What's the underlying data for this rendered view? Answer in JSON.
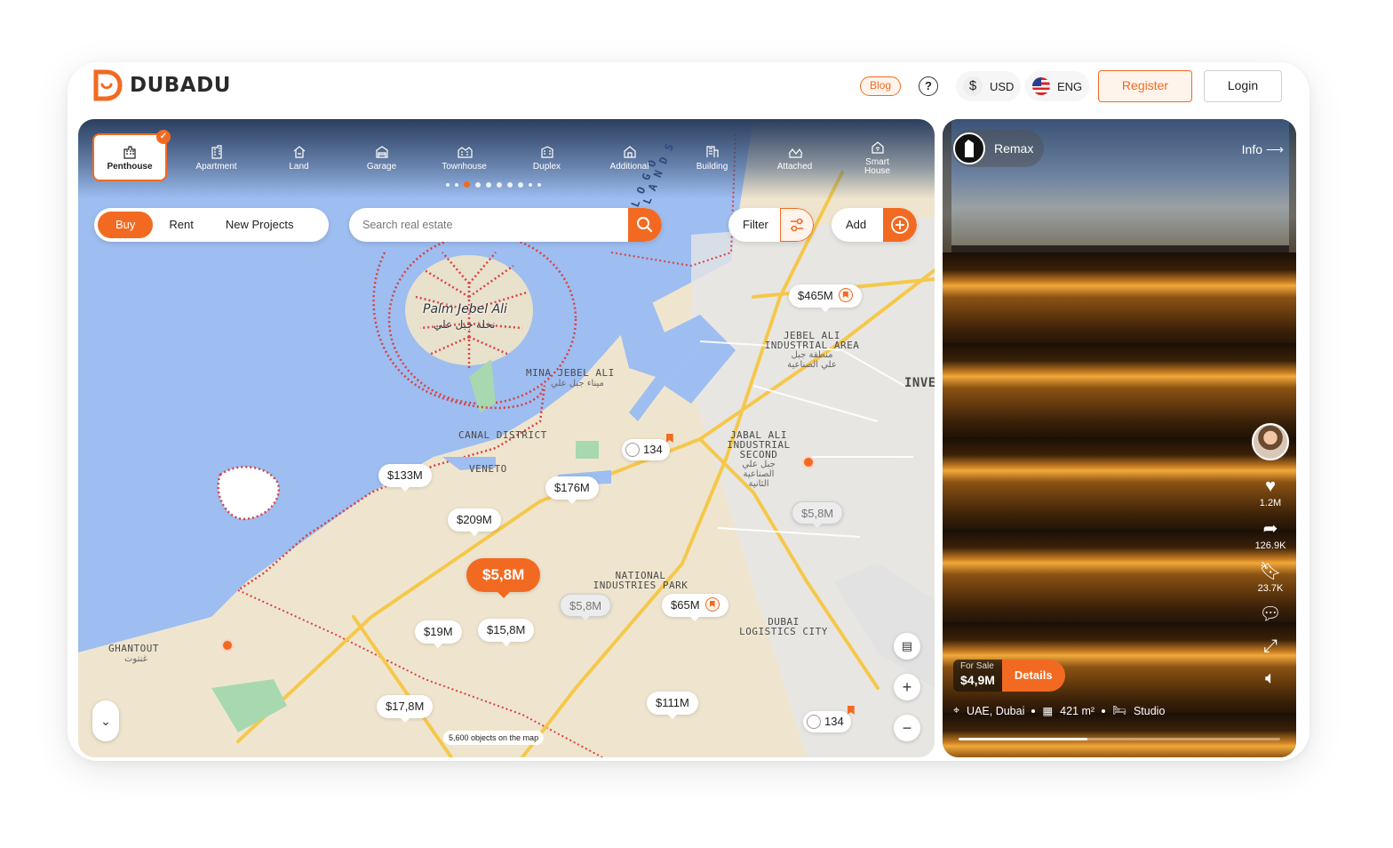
{
  "brand": {
    "name": "DUBADU",
    "accent": "#f26a21"
  },
  "header": {
    "blog_label": "Blog",
    "currency": "USD",
    "language": "ENG",
    "register_label": "Register",
    "login_label": "Login"
  },
  "categories": [
    {
      "label": "Penthouse",
      "icon": "penthouse-icon",
      "active": true
    },
    {
      "label": "Apartment",
      "icon": "apartment-icon"
    },
    {
      "label": "Land",
      "icon": "land-icon"
    },
    {
      "label": "Garage",
      "icon": "garage-icon"
    },
    {
      "label": "Townhouse",
      "icon": "townhouse-icon"
    },
    {
      "label": "Duplex",
      "icon": "duplex-icon"
    },
    {
      "label": "Additional",
      "icon": "additional-icon"
    },
    {
      "label": "Building",
      "icon": "building-icon"
    },
    {
      "label": "Attached",
      "icon": "attached-icon"
    },
    {
      "label": "Smart House",
      "icon": "smart-house-icon"
    }
  ],
  "deal_types": {
    "buy": "Buy",
    "rent": "Rent",
    "new_projects": "New Projects",
    "selected": "Buy"
  },
  "search": {
    "placeholder": "Search real estate",
    "value": ""
  },
  "filter_label": "Filter",
  "add_label": "Add",
  "map": {
    "labels": {
      "palm": "Palm Jebel Ali",
      "palm_ar": "نخلة جبل علي",
      "mina": "MINA JEBEL ALI",
      "mina_ar": "ميناء جبل علي",
      "jebel_ali": "JEBEL ALI",
      "industrial_area": "INDUSTRIAL AREA",
      "jebel_ali_ar1": "منطقة جبل",
      "jebel_ali_ar2": "علي الصناعية",
      "inve": "INVE",
      "canal": "CANAL DISTRICT",
      "veneto": "VENETO",
      "jabal1": "JABAL ALI",
      "jabal2": "INDUSTRIAL",
      "jabal3": "SECOND",
      "jabal_ar1": "جبل علي",
      "jabal_ar2": "الصناعية",
      "jabal_ar3": "الثانية",
      "national1": "NATIONAL",
      "national2": "INDUSTRIES PARK",
      "dubai1": "DUBAI",
      "dubai2": "LOGISTICS CITY",
      "ghantout": "GHANTOUT",
      "ghantout_ar": "غنتوت",
      "logo_islands": "LOGO ISLANDS"
    },
    "price_pins": {
      "p465": "$465M",
      "p133": "$133M",
      "p176": "$176M",
      "p209": "$209M",
      "p58_main": "$5,8M",
      "p58_grey1": "$5,8M",
      "p58_grey2": "$5,8M",
      "p65": "$65M",
      "p19": "$19M",
      "p158": "$15,8M",
      "p178": "$17,8M",
      "p111": "$111M"
    },
    "clusters": {
      "c1": "134",
      "c2": "134"
    },
    "objects_count": "5,600 objects on the map"
  },
  "video": {
    "agency": "Remax",
    "info_label": "Info",
    "likes": "1.2M",
    "shares": "126.9K",
    "saves": "23.7K",
    "for_sale": "For Sale",
    "price": "$4,9M",
    "details_label": "Details",
    "location": "UAE, Dubai",
    "area": "421 m²",
    "type": "Studio",
    "progress": 0.4
  }
}
